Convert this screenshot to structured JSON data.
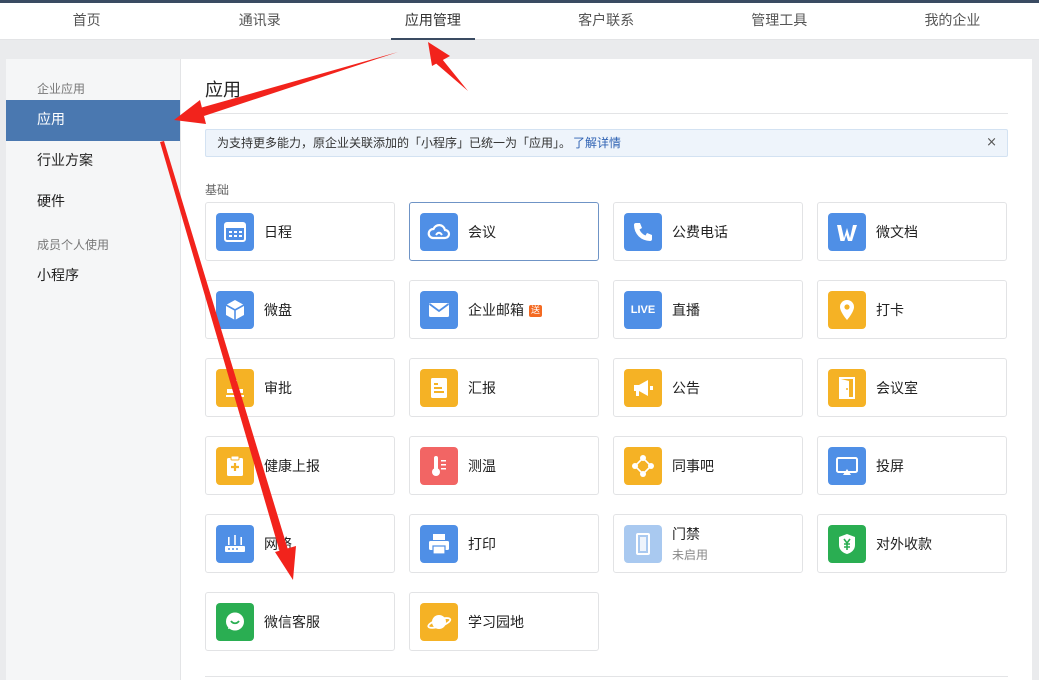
{
  "nav": [
    "首页",
    "通讯录",
    "应用管理",
    "客户联系",
    "管理工具",
    "我的企业"
  ],
  "sidebar": {
    "group1": "企业应用",
    "items1": [
      "应用",
      "行业方案",
      "硬件"
    ],
    "group2": "成员个人使用",
    "items2": [
      "小程序"
    ]
  },
  "main": {
    "title": "应用",
    "notice_text": "为支持更多能力，原企业关联添加的「小程序」已统一为「应用」。",
    "notice_link": "了解详情",
    "notice_close": "×",
    "section": "基础"
  },
  "apps": [
    {
      "label": "日程",
      "icon": "calendar-icon",
      "color": "#4f8fe6"
    },
    {
      "label": "会议",
      "icon": "cloud-meeting-icon",
      "color": "#4f8fe6"
    },
    {
      "label": "公费电话",
      "icon": "phone-icon",
      "color": "#4f8fe6"
    },
    {
      "label": "微文档",
      "icon": "w-doc-icon",
      "color": "#4f8fe6"
    },
    {
      "label": "微盘",
      "icon": "cube-icon",
      "color": "#4f8fe6"
    },
    {
      "label": "企业邮箱",
      "icon": "mail-icon",
      "color": "#4f8fe6",
      "badge": "送"
    },
    {
      "label": "直播",
      "icon": "live-icon",
      "color": "#4f8fe6",
      "icon_text": "LIVE"
    },
    {
      "label": "打卡",
      "icon": "location-pin-icon",
      "color": "#f5b225"
    },
    {
      "label": "审批",
      "icon": "stamp-icon",
      "color": "#f5b225"
    },
    {
      "label": "汇报",
      "icon": "report-icon",
      "color": "#f5b225"
    },
    {
      "label": "公告",
      "icon": "megaphone-icon",
      "color": "#f5b225"
    },
    {
      "label": "会议室",
      "icon": "door-icon",
      "color": "#f5b225"
    },
    {
      "label": "健康上报",
      "icon": "clipboard-plus-icon",
      "color": "#f5b225"
    },
    {
      "label": "测温",
      "icon": "thermometer-icon",
      "color": "#f26564"
    },
    {
      "label": "同事吧",
      "icon": "network-icon",
      "color": "#f5b225"
    },
    {
      "label": "投屏",
      "icon": "screen-cast-icon",
      "color": "#4f8fe6"
    },
    {
      "label": "网络",
      "icon": "router-icon",
      "color": "#4f8fe6"
    },
    {
      "label": "打印",
      "icon": "printer-icon",
      "color": "#4f8fe6"
    },
    {
      "label": "门禁",
      "icon": "access-door-icon",
      "color": "#a9c9f0",
      "sub": "未启用"
    },
    {
      "label": "对外收款",
      "icon": "payment-shield-icon",
      "color": "#2aae52"
    },
    {
      "label": "微信客服",
      "icon": "chat-bubble-icon",
      "color": "#2aae52"
    },
    {
      "label": "学习园地",
      "icon": "planet-icon",
      "color": "#f5b225"
    }
  ]
}
